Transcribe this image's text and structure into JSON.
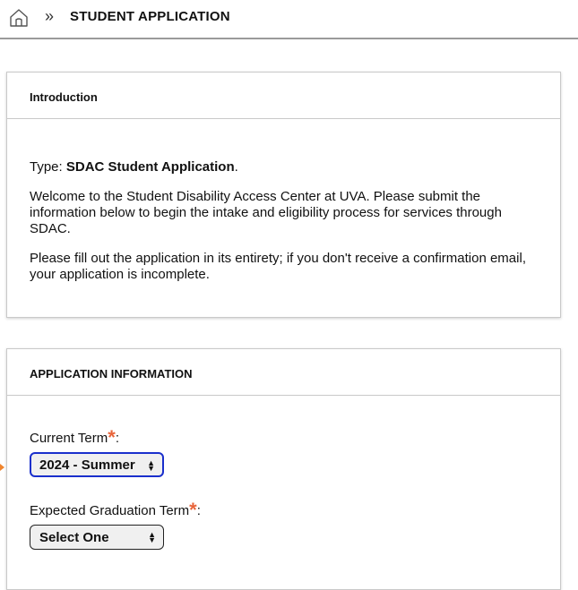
{
  "breadcrumb": {
    "home_icon": "home-icon",
    "separator": "»",
    "title": "STUDENT APPLICATION"
  },
  "intro": {
    "header": "Introduction",
    "type_prefix": "Type: ",
    "type_value": "SDAC Student Application",
    "type_suffix": ".",
    "paragraph1": "Welcome to the Student Disability Access Center at UVA. Please submit the information below to begin the intake and eligibility process for services through SDAC.",
    "paragraph2": "Please fill out the application in its entirety; if you don't receive a confirmation email, your application is incomplete."
  },
  "application": {
    "header": "APPLICATION INFORMATION",
    "current_term": {
      "label": "Current Term",
      "required_mark": "*",
      "colon": ":",
      "value": "2024 - Summer"
    },
    "graduation_term": {
      "label": "Expected Graduation Term",
      "required_mark": "*",
      "colon": ":",
      "value": "Select One"
    }
  },
  "colors": {
    "required": "#e8643a",
    "focus_border": "#1a2fcc",
    "focus_marker": "#f0852d"
  }
}
